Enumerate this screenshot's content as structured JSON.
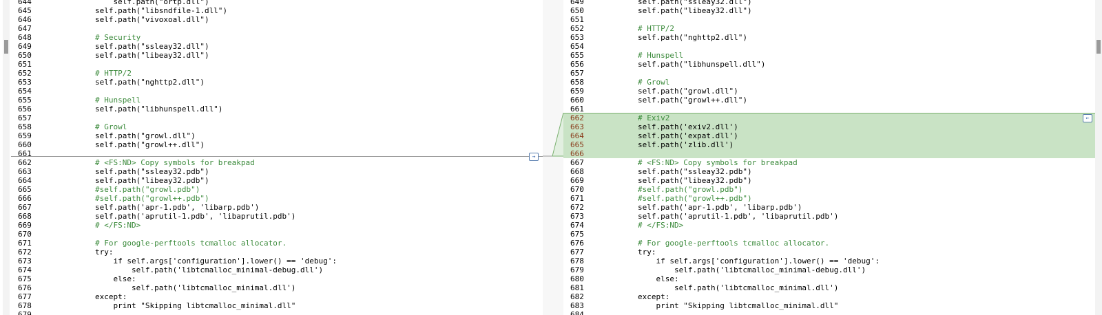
{
  "left": {
    "lines": [
      {
        "n": "644",
        "t": "    self.path(\"ortp.dll\")"
      },
      {
        "n": "645",
        "t": "self.path(\"libsndfile-1.dll\")"
      },
      {
        "n": "646",
        "t": "self.path(\"vivoxoal.dll\")"
      },
      {
        "n": "647",
        "t": ""
      },
      {
        "n": "648",
        "t": "# Security",
        "c": true
      },
      {
        "n": "649",
        "t": "self.path(\"ssleay32.dll\")"
      },
      {
        "n": "650",
        "t": "self.path(\"libeay32.dll\")"
      },
      {
        "n": "651",
        "t": ""
      },
      {
        "n": "652",
        "t": "# HTTP/2",
        "c": true
      },
      {
        "n": "653",
        "t": "self.path(\"nghttp2.dll\")"
      },
      {
        "n": "654",
        "t": ""
      },
      {
        "n": "655",
        "t": "# Hunspell",
        "c": true
      },
      {
        "n": "656",
        "t": "self.path(\"libhunspell.dll\")"
      },
      {
        "n": "657",
        "t": ""
      },
      {
        "n": "658",
        "t": "# Growl",
        "c": true
      },
      {
        "n": "659",
        "t": "self.path(\"growl.dll\")"
      },
      {
        "n": "660",
        "t": "self.path(\"growl++.dll\")"
      },
      {
        "n": "661",
        "t": ""
      },
      {
        "n": "662",
        "t": "# <FS:ND> Copy symbols for breakpad",
        "c": true
      },
      {
        "n": "663",
        "t": "self.path(\"ssleay32.pdb\")"
      },
      {
        "n": "664",
        "t": "self.path(\"libeay32.pdb\")"
      },
      {
        "n": "665",
        "t": "#self.path(\"growl.pdb\")",
        "c": true
      },
      {
        "n": "666",
        "t": "#self.path(\"growl++.pdb\")",
        "c": true
      },
      {
        "n": "667",
        "t": "self.path('apr-1.pdb', 'libarp.pdb')"
      },
      {
        "n": "668",
        "t": "self.path('aprutil-1.pdb', 'libaprutil.pdb')"
      },
      {
        "n": "669",
        "t": "# </FS:ND>",
        "c": true
      },
      {
        "n": "670",
        "t": ""
      },
      {
        "n": "671",
        "t": "# For google-perftools tcmalloc allocator.",
        "c": true
      },
      {
        "n": "672",
        "t": "try:"
      },
      {
        "n": "673",
        "t": "    if self.args['configuration'].lower() == 'debug':"
      },
      {
        "n": "674",
        "t": "        self.path('libtcmalloc_minimal-debug.dll')"
      },
      {
        "n": "675",
        "t": "    else:"
      },
      {
        "n": "676",
        "t": "        self.path('libtcmalloc_minimal.dll')"
      },
      {
        "n": "677",
        "t": "except:"
      },
      {
        "n": "678",
        "t": "    print \"Skipping libtcmalloc_minimal.dll\""
      },
      {
        "n": "679",
        "t": ""
      }
    ]
  },
  "right": {
    "lines": [
      {
        "n": "649",
        "t": "self.path(\"ssleay32.dll\")"
      },
      {
        "n": "650",
        "t": "self.path(\"libeay32.dll\")"
      },
      {
        "n": "651",
        "t": ""
      },
      {
        "n": "652",
        "t": "# HTTP/2",
        "c": true
      },
      {
        "n": "653",
        "t": "self.path(\"nghttp2.dll\")"
      },
      {
        "n": "654",
        "t": ""
      },
      {
        "n": "655",
        "t": "# Hunspell",
        "c": true
      },
      {
        "n": "656",
        "t": "self.path(\"libhunspell.dll\")"
      },
      {
        "n": "657",
        "t": ""
      },
      {
        "n": "658",
        "t": "# Growl",
        "c": true
      },
      {
        "n": "659",
        "t": "self.path(\"growl.dll\")"
      },
      {
        "n": "660",
        "t": "self.path(\"growl++.dll\")"
      },
      {
        "n": "661",
        "t": ""
      },
      {
        "n": "662",
        "t": "# Exiv2",
        "c": true,
        "hl": true
      },
      {
        "n": "663",
        "t": "self.path('exiv2.dll')",
        "hl": true
      },
      {
        "n": "664",
        "t": "self.path('expat.dll')",
        "hl": true
      },
      {
        "n": "665",
        "t": "self.path('zlib.dll')",
        "hl": true
      },
      {
        "n": "666",
        "t": "",
        "hl": true
      },
      {
        "n": "667",
        "t": "# <FS:ND> Copy symbols for breakpad",
        "c": true
      },
      {
        "n": "668",
        "t": "self.path(\"ssleay32.pdb\")"
      },
      {
        "n": "669",
        "t": "self.path(\"libeay32.pdb\")"
      },
      {
        "n": "670",
        "t": "#self.path(\"growl.pdb\")",
        "c": true
      },
      {
        "n": "671",
        "t": "#self.path(\"growl++.pdb\")",
        "c": true
      },
      {
        "n": "672",
        "t": "self.path('apr-1.pdb', 'libarp.pdb')"
      },
      {
        "n": "673",
        "t": "self.path('aprutil-1.pdb', 'libaprutil.pdb')"
      },
      {
        "n": "674",
        "t": "# </FS:ND>",
        "c": true
      },
      {
        "n": "675",
        "t": ""
      },
      {
        "n": "676",
        "t": "# For google-perftools tcmalloc allocator.",
        "c": true
      },
      {
        "n": "677",
        "t": "try:"
      },
      {
        "n": "678",
        "t": "    if self.args['configuration'].lower() == 'debug':"
      },
      {
        "n": "679",
        "t": "        self.path('libtcmalloc_minimal-debug.dll')"
      },
      {
        "n": "680",
        "t": "    else:"
      },
      {
        "n": "681",
        "t": "        self.path('libtcmalloc_minimal.dll')"
      },
      {
        "n": "682",
        "t": "except:"
      },
      {
        "n": "683",
        "t": "    print \"Skipping libtcmalloc_minimal.dll\""
      },
      {
        "n": "684",
        "t": ""
      }
    ]
  },
  "buttons": {
    "copy_left_icon": "copy-to-right-icon",
    "copy_right_icon": "copy-to-left-icon",
    "copy_left_glyph": "→",
    "copy_right_glyph": "←"
  },
  "colors": {
    "comment": "#3b8a3b",
    "added": "#c9e3c5",
    "added_border": "#7ab06f"
  }
}
